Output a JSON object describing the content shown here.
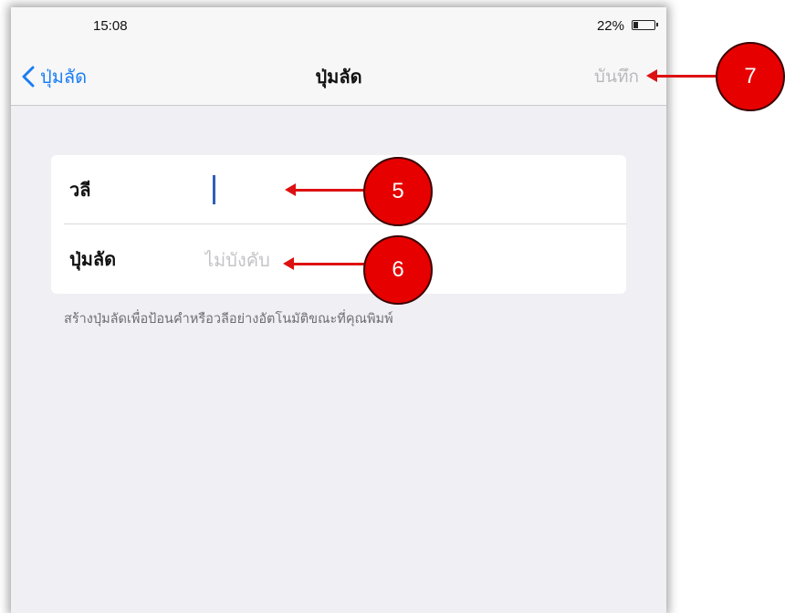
{
  "status_bar": {
    "time": "15:08",
    "battery": "22%"
  },
  "nav": {
    "back_label": "ปุ่มลัด",
    "title": "ปุ่มลัด",
    "save_label": "บันทึก"
  },
  "form": {
    "phrase": {
      "label": "วลี",
      "value": ""
    },
    "shortcut": {
      "label": "ปุ่มลัด",
      "placeholder": "ไม่บังคับ"
    }
  },
  "footnote": "สร้างปุ่มลัดเพื่อป้อนคำหรือวลีอย่างอัตโนมัติขณะที่คุณพิมพ์",
  "callouts": [
    "5",
    "6",
    "7"
  ],
  "colors": {
    "accent": "#1a7ef5",
    "callout": "#e60000",
    "background": "#efeff4"
  },
  "icons": {
    "back": "chevron-left-icon",
    "battery": "battery-icon"
  }
}
